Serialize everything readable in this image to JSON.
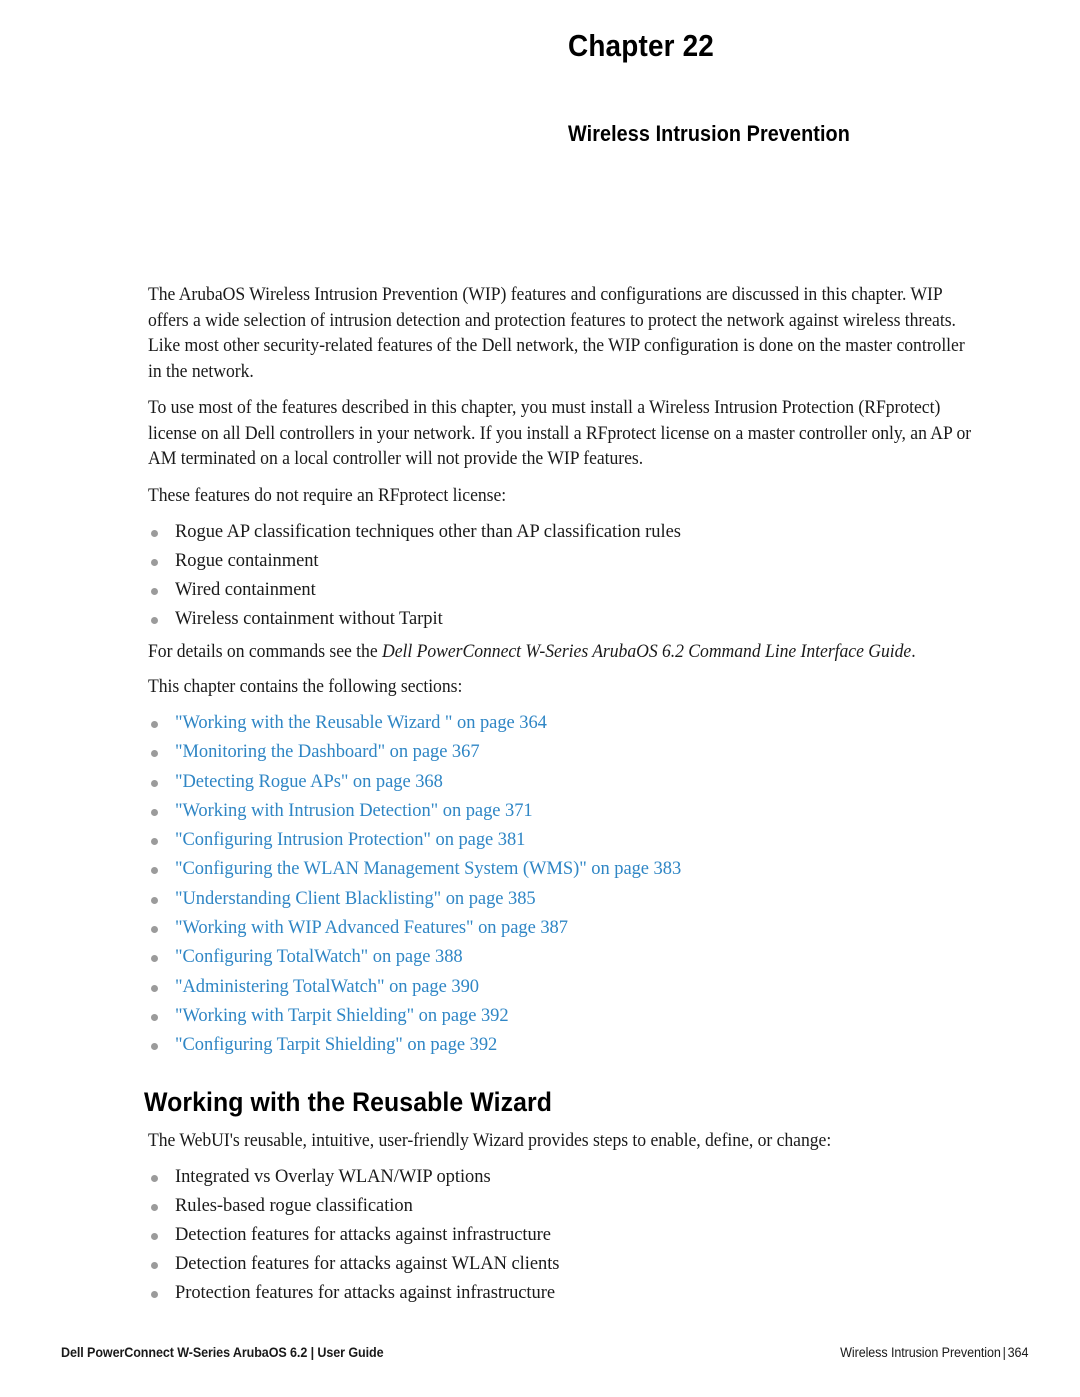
{
  "header": {
    "chapter_label": "Chapter 22",
    "chapter_subtitle": "Wireless Intrusion Prevention"
  },
  "intro": {
    "paragraph_1": "The ArubaOS Wireless Intrusion Prevention (WIP) features and configurations are discussed in this chapter. WIP offers a wide selection of intrusion detection and protection features to protect the network against wireless threats. Like most other security-related features of the Dell network, the WIP configuration is done on the master controller in the network.",
    "paragraph_2": "To use most of the features described in this chapter, you must install a Wireless Intrusion Protection (RFprotect) license on all Dell controllers in your network. If you install a RFprotect license on a master controller only, an AP or AM terminated on a local controller will not provide the WIP features.",
    "no_license_lead": "These features do not require an RFprotect license:",
    "no_license_items": [
      "Rogue AP classification techniques other than AP classification rules",
      "Rogue containment",
      "Wired containment",
      "Wireless containment without Tarpit"
    ],
    "cli_note_prefix": "For details on commands see the ",
    "cli_note_italic": "Dell PowerConnect W-Series ArubaOS 6.2 Command Line Interface Guide",
    "cli_note_suffix": ".",
    "sections_lead": "This chapter contains the following sections:"
  },
  "toc": {
    "links": [
      "\"Working with the Reusable Wizard \" on page 364",
      "\"Monitoring the Dashboard\" on page 367",
      "\"Detecting Rogue APs\" on page 368",
      "\"Working with Intrusion Detection\" on page 371",
      "\"Configuring Intrusion Protection\" on page 381",
      "\"Configuring the WLAN Management System (WMS)\" on page 383",
      "\"Understanding Client Blacklisting\" on page 385",
      "\"Working with WIP Advanced Features\" on page 387",
      "\"Configuring TotalWatch\" on page 388",
      "\"Administering TotalWatch\" on page 390",
      "\"Working with Tarpit Shielding\" on page 392",
      "\"Configuring Tarpit Shielding\" on page 392"
    ],
    "link_color": "#2f86c5"
  },
  "wizard_section": {
    "heading": "Working with the Reusable Wizard",
    "intro": "The WebUI's reusable, intuitive, user-friendly Wizard provides steps to enable, define, or change:",
    "items": [
      "Integrated vs Overlay WLAN/WIP options",
      "Rules-based rogue classification",
      "Detection features for attacks against infrastructure",
      "Detection features for attacks against WLAN clients",
      "Protection features for attacks against infrastructure"
    ]
  },
  "footer": {
    "left": "Dell PowerConnect W-Series ArubaOS 6.2  |  User Guide",
    "right_title": "Wireless Intrusion Prevention",
    "right_separator": "|",
    "right_page": "364"
  }
}
